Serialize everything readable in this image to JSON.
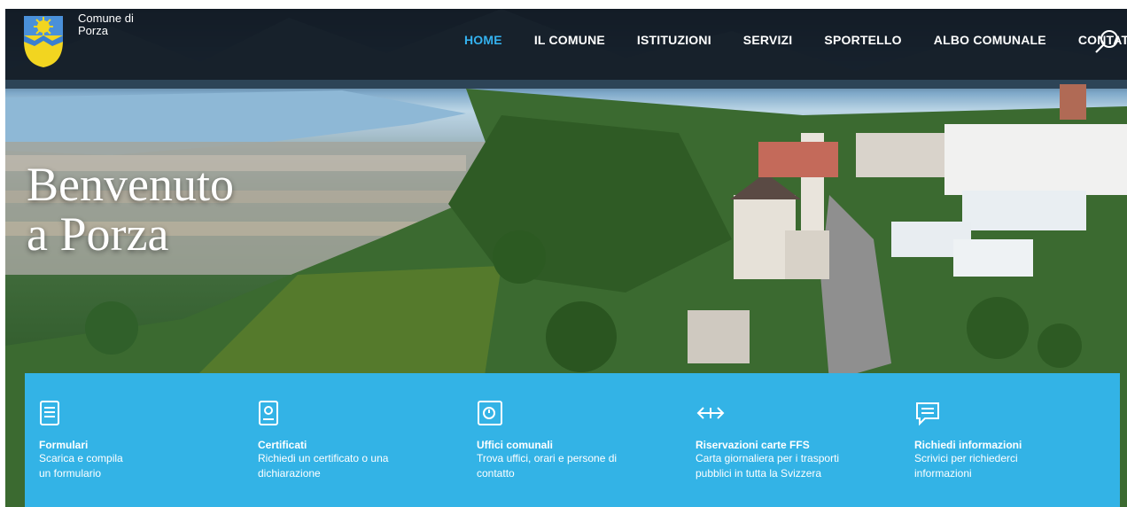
{
  "header": {
    "logo_line1": "Comune di",
    "logo_line2": "Porza",
    "nav": [
      {
        "label": "HOME",
        "active": true
      },
      {
        "label": "IL COMUNE",
        "active": false
      },
      {
        "label": "ISTITUZIONI",
        "active": false
      },
      {
        "label": "SERVIZI",
        "active": false
      },
      {
        "label": "SPORTELLO",
        "active": false
      },
      {
        "label": "ALBO COMUNALE",
        "active": false
      },
      {
        "label": "CONTATTI",
        "active": false
      }
    ],
    "search_icon": "search-icon"
  },
  "hero": {
    "title_line1": "Benvenuto",
    "title_line2": "a Porza"
  },
  "services": [
    {
      "icon": "form-icon",
      "title": "Formulari",
      "desc_line1": "Scarica e compila",
      "desc_line2": "un formulario"
    },
    {
      "icon": "certificate-icon",
      "title": "Certificati",
      "desc_line1": "Richiedi un certificato o una",
      "desc_line2": "dichiarazione"
    },
    {
      "icon": "office-icon",
      "title": "Uffici comunali",
      "desc_line1": "Trova uffici, orari e  persone di",
      "desc_line2": "contatto"
    },
    {
      "icon": "exchange-icon",
      "title": "Riservazioni carte FFS",
      "desc_line1": "Carta giornaliera per i trasporti",
      "desc_line2": "pubblici in tutta la Svizzera"
    },
    {
      "icon": "chat-icon",
      "title": "Richiedi informazioni",
      "desc_line1": "Scrivici per richiederci",
      "desc_line2": "informazioni"
    }
  ],
  "colors": {
    "accent": "#34b2ef",
    "panel": "#33b3e6",
    "nav_bg": "#121a22"
  }
}
